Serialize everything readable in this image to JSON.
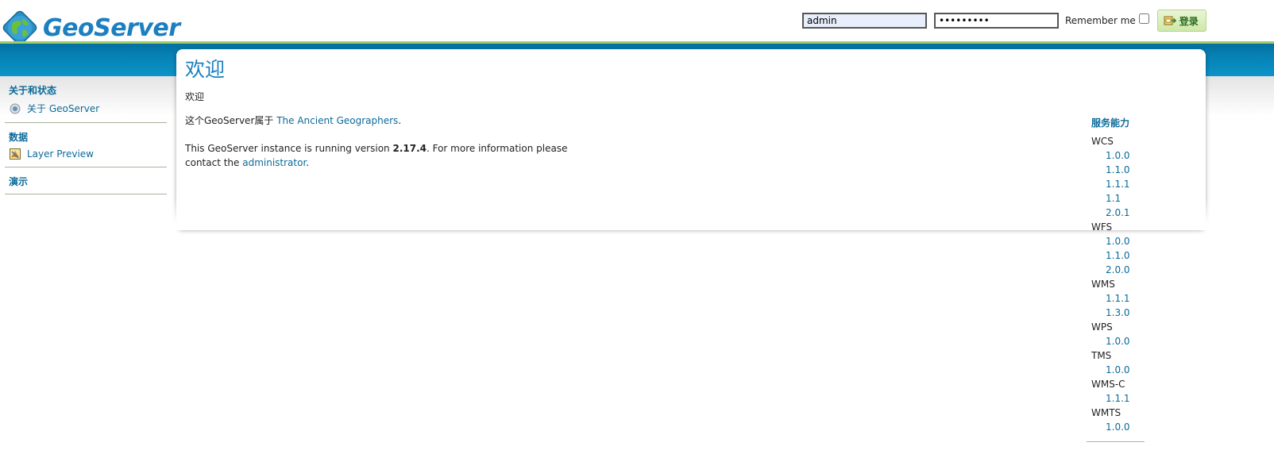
{
  "header": {
    "brand": "GeoServer",
    "login": {
      "username_value": "admin",
      "password_value": "•••••••••",
      "remember_label": "Remember me",
      "login_button": "登录"
    }
  },
  "sidebar": {
    "sections": [
      {
        "title": "关于和状态",
        "items": [
          {
            "label": "关于 GeoServer",
            "icon": "info-icon"
          }
        ]
      },
      {
        "title": "数据",
        "items": [
          {
            "label": "Layer Preview",
            "icon": "layer-preview-icon"
          }
        ]
      },
      {
        "title": "演示",
        "items": []
      }
    ]
  },
  "main": {
    "title": "欢迎",
    "welcome": "欢迎",
    "owner_prefix": "这个GeoServer属于 ",
    "owner_link": "The Ancient Geographers",
    "owner_suffix": ".",
    "version_prefix": "This GeoServer instance is running version ",
    "version": "2.17.4",
    "version_middle": ". For more information please contact the ",
    "admin_link": "administrator",
    "version_suffix": "."
  },
  "capabilities": {
    "title": "服务能力",
    "services": [
      {
        "name": "WCS",
        "versions": [
          "1.0.0",
          "1.1.0",
          "1.1.1",
          "1.1",
          "2.0.1"
        ]
      },
      {
        "name": "WFS",
        "versions": [
          "1.0.0",
          "1.1.0",
          "2.0.0"
        ]
      },
      {
        "name": "WMS",
        "versions": [
          "1.1.1",
          "1.3.0"
        ]
      },
      {
        "name": "WPS",
        "versions": [
          "1.0.0"
        ]
      },
      {
        "name": "TMS",
        "versions": [
          "1.0.0"
        ]
      },
      {
        "name": "WMS-C",
        "versions": [
          "1.1.1"
        ]
      },
      {
        "name": "WMTS",
        "versions": [
          "1.0.0"
        ]
      }
    ]
  },
  "colors": {
    "accent": "#1b7fc0",
    "band": "#0782b5",
    "link": "#0b6a9a"
  }
}
